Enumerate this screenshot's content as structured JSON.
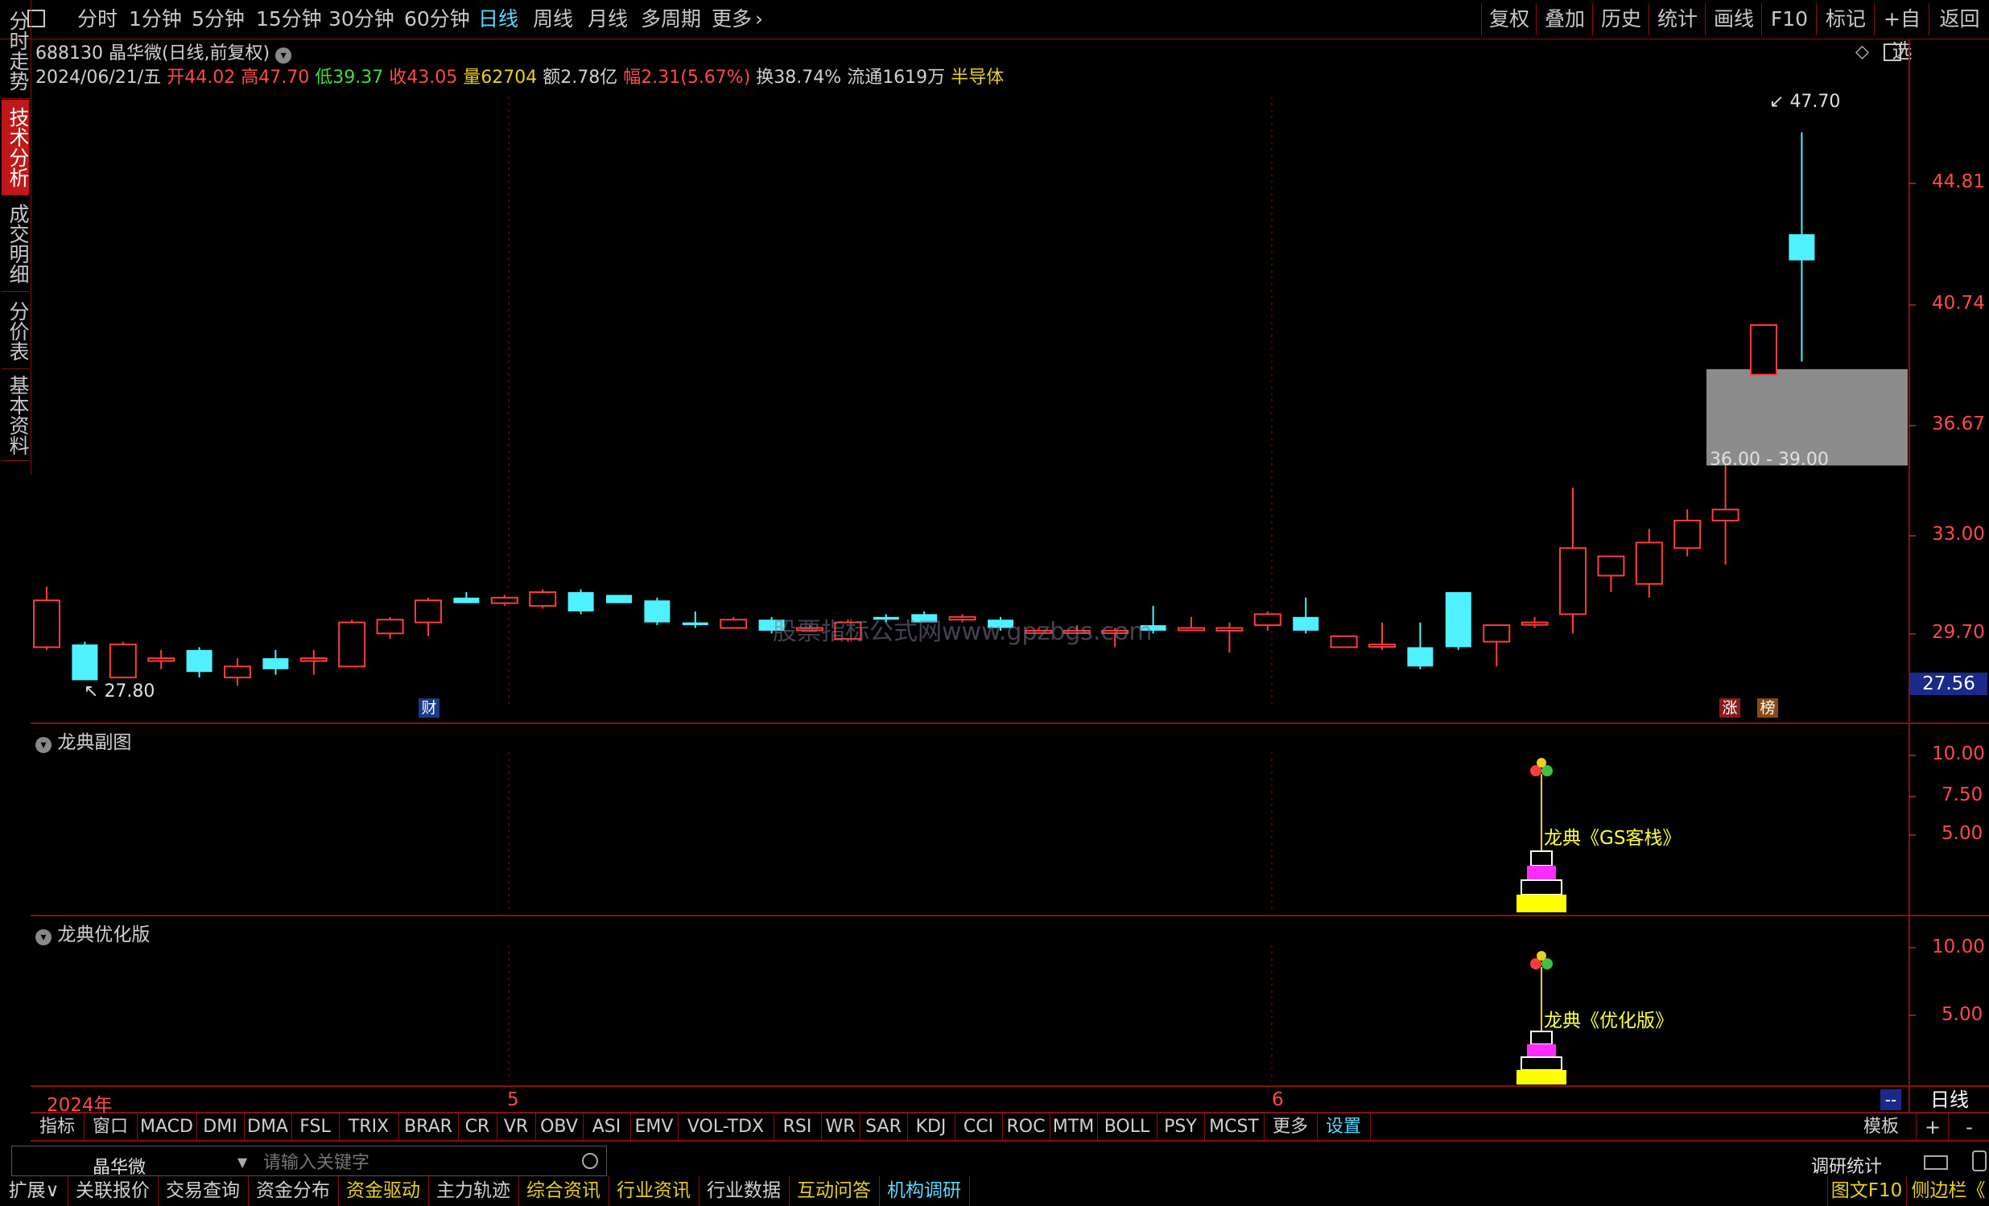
{
  "toolbar": {
    "timeframes": [
      "分时",
      "1分钟",
      "5分钟",
      "15分钟",
      "30分钟",
      "60分钟",
      "日线",
      "周线",
      "月线",
      "多周期",
      "更多"
    ],
    "active_timeframe": "日线",
    "right_buttons": [
      "复权",
      "叠加",
      "历史",
      "统计",
      "画线",
      "F10",
      "标记",
      "+自选",
      "返回"
    ]
  },
  "left_tabs": [
    "分时走势",
    "技术分析",
    "成交明细",
    "分价表",
    "基本资料"
  ],
  "active_left_tab": "技术分析",
  "stock": {
    "title": "688130 晶华微(日线,前复权)",
    "date": "2024/06/21/五",
    "open_label": "开",
    "open": "44.02",
    "high_label": "高",
    "high": "47.70",
    "low_label": "低",
    "low": "39.37",
    "close_label": "收",
    "close": "43.05",
    "vol_label": "量",
    "vol": "62704",
    "amount": "额2.78亿",
    "change_label": "幅",
    "change": "2.31(5.67%)",
    "turnover": "换38.74%",
    "float": "流通1619万",
    "sector": "半导体"
  },
  "main_chart": {
    "y_ticks": [
      "44.81",
      "40.74",
      "36.67",
      "33.00",
      "29.70"
    ],
    "current_price_tag": "27.56",
    "high_marker": "47.70",
    "low_marker": "27.80",
    "zone_label": "36.00 - 39.00",
    "zone": {
      "low": 36.0,
      "high": 39.0
    },
    "badge_cai": "财",
    "badge_zhang": "涨",
    "badge_bang": "榜",
    "watermark": "股票指标公式网www.gpzbgs.com",
    "months": [
      "2024年",
      "5",
      "6"
    ],
    "colors": {
      "up": "#ff3c3c",
      "down": "#4ff0ff"
    }
  },
  "chart_data": {
    "type": "candlestick",
    "ylim": [
      26.5,
      49.0
    ],
    "candles": [
      {
        "o": 29.0,
        "h": 31.2,
        "l": 28.9,
        "c": 30.7
      },
      {
        "o": 29.1,
        "h": 29.2,
        "l": 27.8,
        "c": 27.8
      },
      {
        "o": 27.9,
        "h": 29.2,
        "l": 27.9,
        "c": 29.1
      },
      {
        "o": 28.5,
        "h": 28.9,
        "l": 28.2,
        "c": 28.6
      },
      {
        "o": 28.9,
        "h": 29.0,
        "l": 27.9,
        "c": 28.1
      },
      {
        "o": 27.9,
        "h": 28.6,
        "l": 27.6,
        "c": 28.3
      },
      {
        "o": 28.6,
        "h": 28.9,
        "l": 28.0,
        "c": 28.2
      },
      {
        "o": 28.5,
        "h": 28.9,
        "l": 28.0,
        "c": 28.6
      },
      {
        "o": 28.3,
        "h": 30.0,
        "l": 28.3,
        "c": 29.9
      },
      {
        "o": 29.5,
        "h": 30.1,
        "l": 29.3,
        "c": 30.0
      },
      {
        "o": 29.9,
        "h": 30.8,
        "l": 29.4,
        "c": 30.7
      },
      {
        "o": 30.8,
        "h": 31.0,
        "l": 30.6,
        "c": 30.6
      },
      {
        "o": 30.6,
        "h": 30.9,
        "l": 30.5,
        "c": 30.8
      },
      {
        "o": 30.5,
        "h": 31.1,
        "l": 30.4,
        "c": 31.0
      },
      {
        "o": 31.0,
        "h": 31.1,
        "l": 30.2,
        "c": 30.3
      },
      {
        "o": 30.9,
        "h": 30.9,
        "l": 30.6,
        "c": 30.6
      },
      {
        "o": 30.7,
        "h": 30.8,
        "l": 29.8,
        "c": 29.9
      },
      {
        "o": 29.9,
        "h": 30.3,
        "l": 29.7,
        "c": 29.8
      },
      {
        "o": 29.7,
        "h": 30.1,
        "l": 29.7,
        "c": 30.0
      },
      {
        "o": 30.0,
        "h": 30.1,
        "l": 29.5,
        "c": 29.6
      },
      {
        "o": 29.7,
        "h": 29.8,
        "l": 29.6,
        "c": 29.7
      },
      {
        "o": 29.3,
        "h": 30.0,
        "l": 29.2,
        "c": 29.9
      },
      {
        "o": 30.1,
        "h": 30.2,
        "l": 29.9,
        "c": 30.0
      },
      {
        "o": 30.2,
        "h": 30.3,
        "l": 29.9,
        "c": 29.9
      },
      {
        "o": 30.0,
        "h": 30.2,
        "l": 29.9,
        "c": 30.1
      },
      {
        "o": 30.0,
        "h": 30.1,
        "l": 29.6,
        "c": 29.7
      },
      {
        "o": 29.6,
        "h": 29.7,
        "l": 29.5,
        "c": 29.6
      },
      {
        "o": 29.6,
        "h": 29.8,
        "l": 29.5,
        "c": 29.6
      },
      {
        "o": 29.6,
        "h": 29.7,
        "l": 29.0,
        "c": 29.6
      },
      {
        "o": 29.8,
        "h": 30.5,
        "l": 29.5,
        "c": 29.6
      },
      {
        "o": 29.7,
        "h": 30.1,
        "l": 29.6,
        "c": 29.7
      },
      {
        "o": 29.6,
        "h": 29.9,
        "l": 28.8,
        "c": 29.7
      },
      {
        "o": 29.8,
        "h": 30.3,
        "l": 29.6,
        "c": 30.2
      },
      {
        "o": 30.1,
        "h": 30.8,
        "l": 29.5,
        "c": 29.6
      },
      {
        "o": 29.0,
        "h": 29.4,
        "l": 29.0,
        "c": 29.4
      },
      {
        "o": 29.1,
        "h": 29.9,
        "l": 28.9,
        "c": 29.1
      },
      {
        "o": 29.0,
        "h": 29.9,
        "l": 28.2,
        "c": 28.3
      },
      {
        "o": 31.0,
        "h": 31.0,
        "l": 28.9,
        "c": 29.0
      },
      {
        "o": 29.2,
        "h": 29.8,
        "l": 28.3,
        "c": 29.8
      },
      {
        "o": 29.9,
        "h": 30.1,
        "l": 29.7,
        "c": 29.9
      },
      {
        "o": 30.2,
        "h": 34.8,
        "l": 29.5,
        "c": 32.6
      },
      {
        "o": 31.6,
        "h": 32.3,
        "l": 31.0,
        "c": 32.3
      },
      {
        "o": 31.3,
        "h": 33.3,
        "l": 30.8,
        "c": 32.8
      },
      {
        "o": 32.6,
        "h": 34.0,
        "l": 32.3,
        "c": 33.6
      },
      {
        "o": 33.6,
        "h": 35.6,
        "l": 32.0,
        "c": 34.0
      },
      {
        "o": 38.9,
        "h": 40.7,
        "l": 38.9,
        "c": 40.7
      },
      {
        "o": 44.0,
        "h": 47.7,
        "l": 39.37,
        "c": 43.05
      }
    ]
  },
  "panel1": {
    "title": "龙典副图",
    "y_ticks": [
      "10.00",
      "7.50",
      "5.00"
    ],
    "signal_label": "龙典《GS客栈》"
  },
  "panel2": {
    "title": "龙典优化版",
    "y_ticks": [
      "10.00",
      "5.00"
    ],
    "signal_label": "龙典《优化版》"
  },
  "corner": {
    "dash": "--",
    "period": "日线",
    "plus": "+",
    "minus": "-",
    "template": "模板"
  },
  "indicators": [
    "指标",
    "窗口",
    "MACD",
    "DMI",
    "DMA",
    "FSL",
    "TRIX",
    "BRAR",
    "CR",
    "VR",
    "OBV",
    "ASI",
    "EMV",
    "VOL-TDX",
    "RSI",
    "WR",
    "SAR",
    "KDJ",
    "CCI",
    "ROC",
    "MTM",
    "BOLL",
    "PSY",
    "MCST",
    "更多",
    "设置"
  ],
  "search": {
    "stock_name": "晶华微",
    "placeholder": "请输入关键字",
    "research": "调研统计"
  },
  "bottom_tabs": [
    {
      "label": "扩展∨",
      "color": "#d0d0d0"
    },
    {
      "label": "关联报价",
      "color": "#d0d0d0"
    },
    {
      "label": "交易查询",
      "color": "#d0d0d0"
    },
    {
      "label": "资金分布",
      "color": "#d0d0d0"
    },
    {
      "label": "资金驱动",
      "color": "#e8d020"
    },
    {
      "label": "主力轨迹",
      "color": "#d0d0d0"
    },
    {
      "label": "综合资讯",
      "color": "#e8d020"
    },
    {
      "label": "行业资讯",
      "color": "#e8d020"
    },
    {
      "label": "行业数据",
      "color": "#d0d0d0"
    },
    {
      "label": "互动问答",
      "color": "#e8d020"
    },
    {
      "label": "机构调研",
      "color": "#5ad8ff"
    }
  ],
  "bottom_right": {
    "f10": "图文F10",
    "sidebar": "侧边栏《"
  }
}
